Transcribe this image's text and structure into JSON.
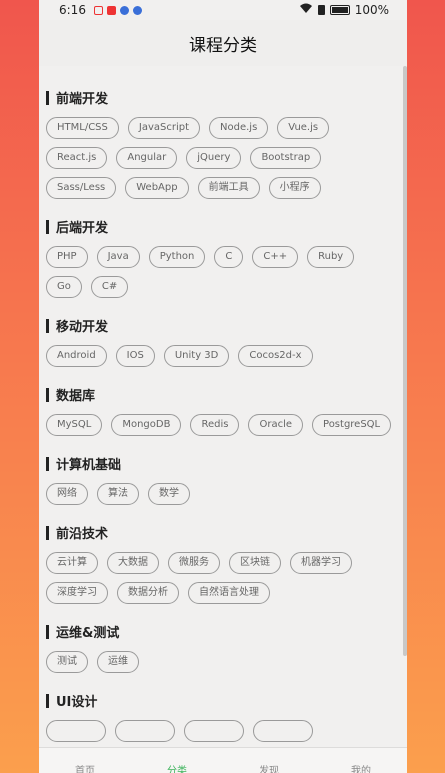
{
  "status": {
    "time": "6:16",
    "battery": "100%"
  },
  "header": {
    "title": "课程分类"
  },
  "sections": [
    {
      "title": "前端开发",
      "tags": [
        "HTML/CSS",
        "JavaScript",
        "Node.js",
        "Vue.js",
        "React.js",
        "Angular",
        "jQuery",
        "Bootstrap",
        "Sass/Less",
        "WebApp",
        "前端工具",
        "小程序"
      ]
    },
    {
      "title": "后端开发",
      "tags": [
        "PHP",
        "Java",
        "Python",
        "C",
        "C++",
        "Ruby",
        "Go",
        "C#"
      ]
    },
    {
      "title": "移动开发",
      "tags": [
        "Android",
        "IOS",
        "Unity 3D",
        "Cocos2d-x"
      ]
    },
    {
      "title": "数据库",
      "tags": [
        "MySQL",
        "MongoDB",
        "Redis",
        "Oracle",
        "PostgreSQL"
      ]
    },
    {
      "title": "计算机基础",
      "tags": [
        "网络",
        "算法",
        "数学"
      ]
    },
    {
      "title": "前沿技术",
      "tags": [
        "云计算",
        "大数据",
        "微服务",
        "区块链",
        "机器学习",
        "深度学习",
        "数据分析",
        "自然语言处理"
      ]
    },
    {
      "title": "运维&测试",
      "tags": [
        "测试",
        "运维"
      ]
    },
    {
      "title": "UI设计",
      "tags": [
        "",
        "",
        "",
        ""
      ]
    }
  ],
  "tabbar": {
    "items": [
      "首页",
      "分类",
      "发现",
      "我的"
    ],
    "active": 1
  },
  "colors": {
    "accent": "#3bb35a",
    "bg_top": "#f0564d",
    "bg_bottom": "#fb9f4d"
  }
}
